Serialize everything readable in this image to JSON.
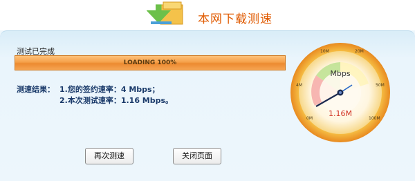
{
  "header": {
    "title": "本网下载测速"
  },
  "status": {
    "label": "测试已完成",
    "progress_text": "LOADING 100%",
    "progress": 1.0
  },
  "results": {
    "title": "测速结果：",
    "line1": "1.您的签约速率：4 Mbps；",
    "line2": "2.本次测试速率：1.16 Mbps。"
  },
  "buttons": {
    "retest": "再次测速",
    "close": "关闭页面"
  },
  "gauge": {
    "unit": "Mbps",
    "reading": "1.16M",
    "scale_labels": [
      "0M",
      "4M",
      "10M",
      "20M",
      "50M",
      "100M"
    ],
    "colors": {
      "ring": "#f0a030",
      "needle": "#2a3a60",
      "readout": "#d03020"
    }
  }
}
